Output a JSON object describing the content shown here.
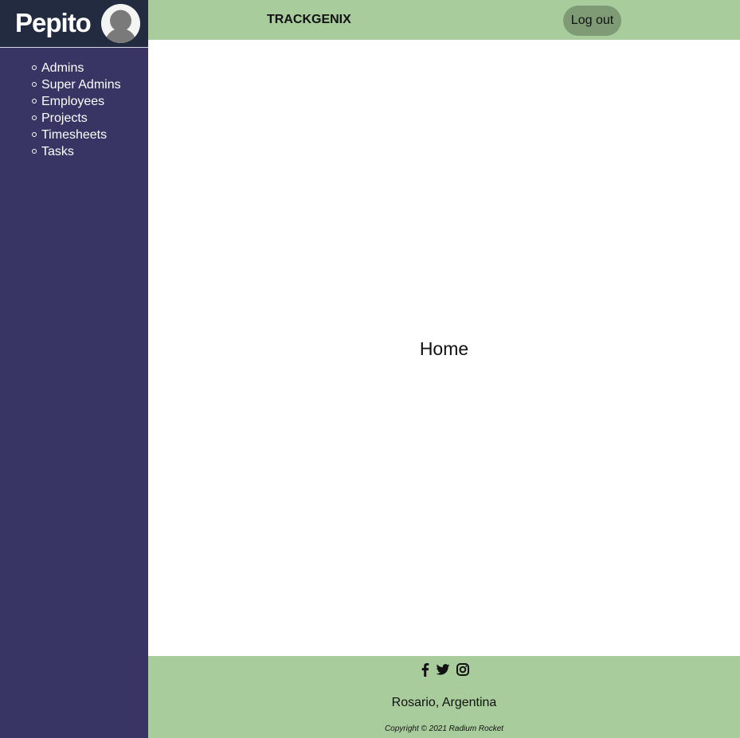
{
  "sidebar": {
    "user_name": "Pepito",
    "avatar_icon": "user-avatar-icon",
    "items": [
      {
        "label": "Admins"
      },
      {
        "label": "Super Admins"
      },
      {
        "label": "Employees"
      },
      {
        "label": "Projects"
      },
      {
        "label": "Timesheets"
      },
      {
        "label": "Tasks"
      }
    ]
  },
  "header": {
    "brand": "TRACKGENIX",
    "logout_label": "Log out"
  },
  "main": {
    "title": "Home"
  },
  "footer": {
    "social_icons": [
      "facebook-icon",
      "twitter-icon",
      "instagram-icon"
    ],
    "location": "Rosario, Argentina",
    "copyright": "Copyright © 2021 Radium Rocket"
  },
  "colors": {
    "sidebar": "#383564",
    "sidebar_header": "#222b3f",
    "header_footer": "#a8cc9c",
    "logout_button": "#7e9b76",
    "main_background": "#ffffff"
  }
}
